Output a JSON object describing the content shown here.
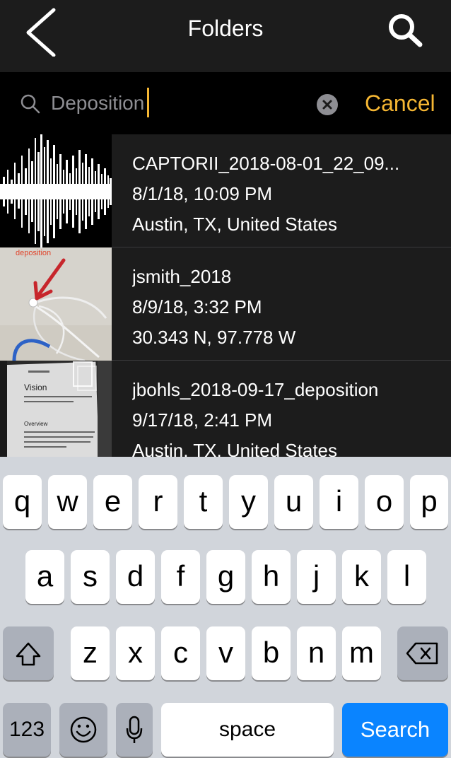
{
  "navbar": {
    "title": "Folders"
  },
  "search": {
    "query": "Deposition",
    "cancel_label": "Cancel"
  },
  "results": [
    {
      "title": "CAPTORII_2018-08-01_22_09...",
      "date": "8/1/18, 10:09 PM",
      "location": "Austin, TX, United States",
      "thumbnail": "audio-waveform"
    },
    {
      "title": "jsmith_2018",
      "date": "8/9/18, 3:32 PM",
      "location": "30.343 N, 97.778 W",
      "thumbnail": "photo-cable",
      "thumbnail_label": "deposition"
    },
    {
      "title": "jbohls_2018-09-17_deposition",
      "date": "9/17/18, 2:41 PM",
      "location": "Austin, TX, United States",
      "thumbnail": "photo-document",
      "thumbnail_text": {
        "heading": "Vision",
        "subheading": "Overview",
        "caption": "Apply computer vision algorithms to perform a variety of tasks on input images and video.",
        "body": "The Vision framework performs face and face landmark detection, text detection, barcode recognition, image registration, and general feature tracking."
      }
    }
  ],
  "keyboard": {
    "row1": [
      "q",
      "w",
      "e",
      "r",
      "t",
      "y",
      "u",
      "i",
      "o",
      "p"
    ],
    "row2": [
      "a",
      "s",
      "d",
      "f",
      "g",
      "h",
      "j",
      "k",
      "l"
    ],
    "row3": [
      "z",
      "x",
      "c",
      "v",
      "b",
      "n",
      "m"
    ],
    "numbers_label": "123",
    "space_label": "space",
    "search_label": "Search"
  },
  "colors": {
    "accent": "#f5b633",
    "search_key": "#0a84ff",
    "navbar_bg": "#1c1c1c",
    "keyboard_bg": "#d1d5db"
  }
}
